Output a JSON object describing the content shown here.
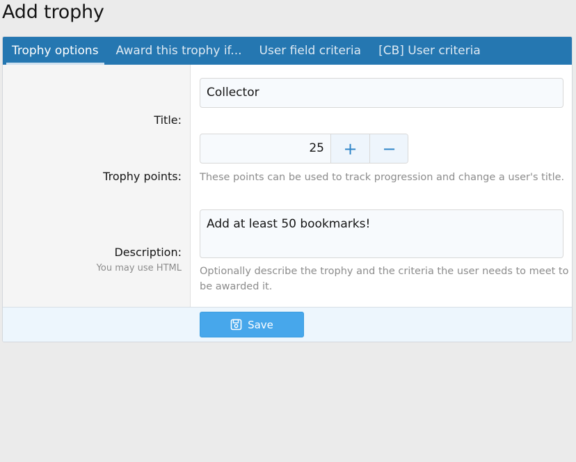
{
  "page": {
    "title": "Add trophy"
  },
  "tabs": [
    {
      "label": "Trophy options",
      "active": true
    },
    {
      "label": "Award this trophy if...",
      "active": false
    },
    {
      "label": "User field criteria",
      "active": false
    },
    {
      "label": "[CB] User criteria",
      "active": false
    }
  ],
  "form": {
    "title": {
      "label": "Title:",
      "value": "Collector"
    },
    "points": {
      "label": "Trophy points:",
      "value": "25",
      "increment_symbol": "+",
      "decrement_symbol": "−",
      "explain": "These points can be used to track progression and change a user's title."
    },
    "description": {
      "label": "Description:",
      "hint": "You may use HTML",
      "value": "Add at least 50 bookmarks!",
      "explain_line1": "Optionally describe the trophy and the criteria the user needs to meet to",
      "explain_line2": "be awarded it."
    }
  },
  "footer": {
    "save_label": "Save",
    "save_icon": "save-icon"
  },
  "colors": {
    "tab_bar": "#2577b1",
    "save_button": "#47a7eb",
    "stepper_icon": "#2f85c8"
  }
}
